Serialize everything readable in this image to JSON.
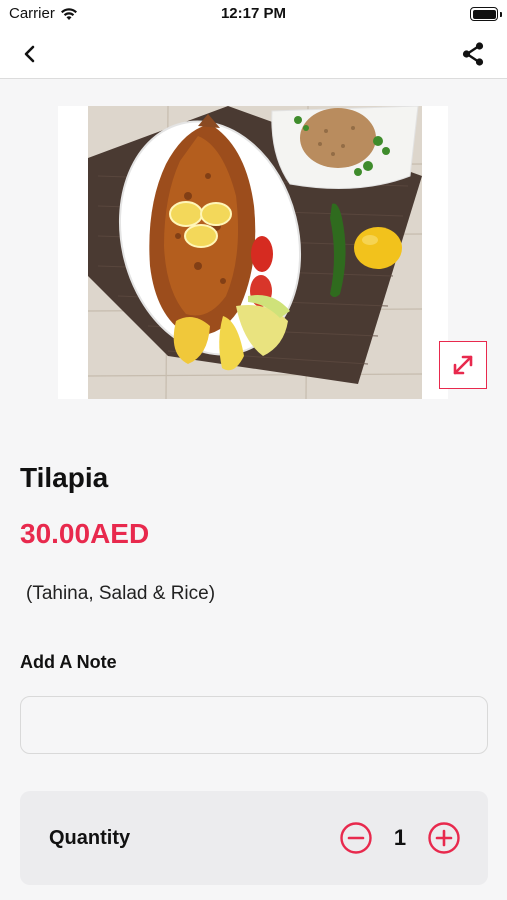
{
  "status_bar": {
    "carrier": "Carrier",
    "time": "12:17 PM"
  },
  "nav": {
    "back_icon": "chevron-left-icon",
    "share_icon": "share-icon"
  },
  "image": {
    "alt": "Grilled tilapia plate with lemon, tomato, chili and rice",
    "expand_icon": "expand-icon"
  },
  "item": {
    "title": "Tilapia",
    "price": "30.00AED",
    "description": "(Tahina, Salad & Rice)"
  },
  "note": {
    "label": "Add A Note",
    "value": ""
  },
  "quantity": {
    "label": "Quantity",
    "value": "1",
    "minus_icon": "minus-circle-icon",
    "plus_icon": "plus-circle-icon"
  },
  "colors": {
    "accent": "#e8294d",
    "background": "#f6f6f7"
  }
}
